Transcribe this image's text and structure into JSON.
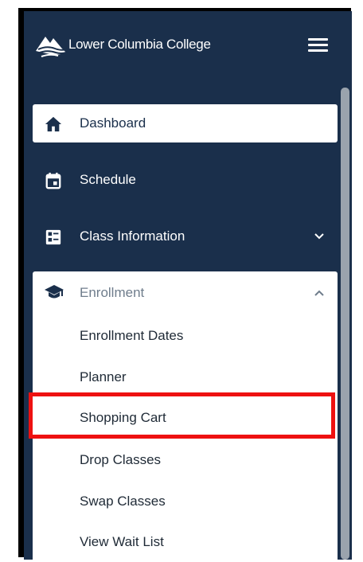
{
  "brand": {
    "name": "Lower Columbia College",
    "logo_icon": "lcc-logo-icon"
  },
  "nav": {
    "dashboard": {
      "label": "Dashboard",
      "icon": "home-icon"
    },
    "schedule": {
      "label": "Schedule",
      "icon": "calendar-icon"
    },
    "class_info": {
      "label": "Class Information",
      "icon": "class-list-icon"
    },
    "enrollment": {
      "label": "Enrollment",
      "icon": "graduation-cap-icon",
      "items": [
        {
          "label": "Enrollment Dates"
        },
        {
          "label": "Planner"
        },
        {
          "label": "Shopping Cart"
        },
        {
          "label": "Drop Classes"
        },
        {
          "label": "Swap Classes"
        },
        {
          "label": "View Wait List"
        }
      ]
    }
  },
  "colors": {
    "sidebar_bg": "#1a2f4b",
    "highlight": "#ee1111",
    "text_light": "#ffffff",
    "text_muted": "#6f7d8c"
  }
}
